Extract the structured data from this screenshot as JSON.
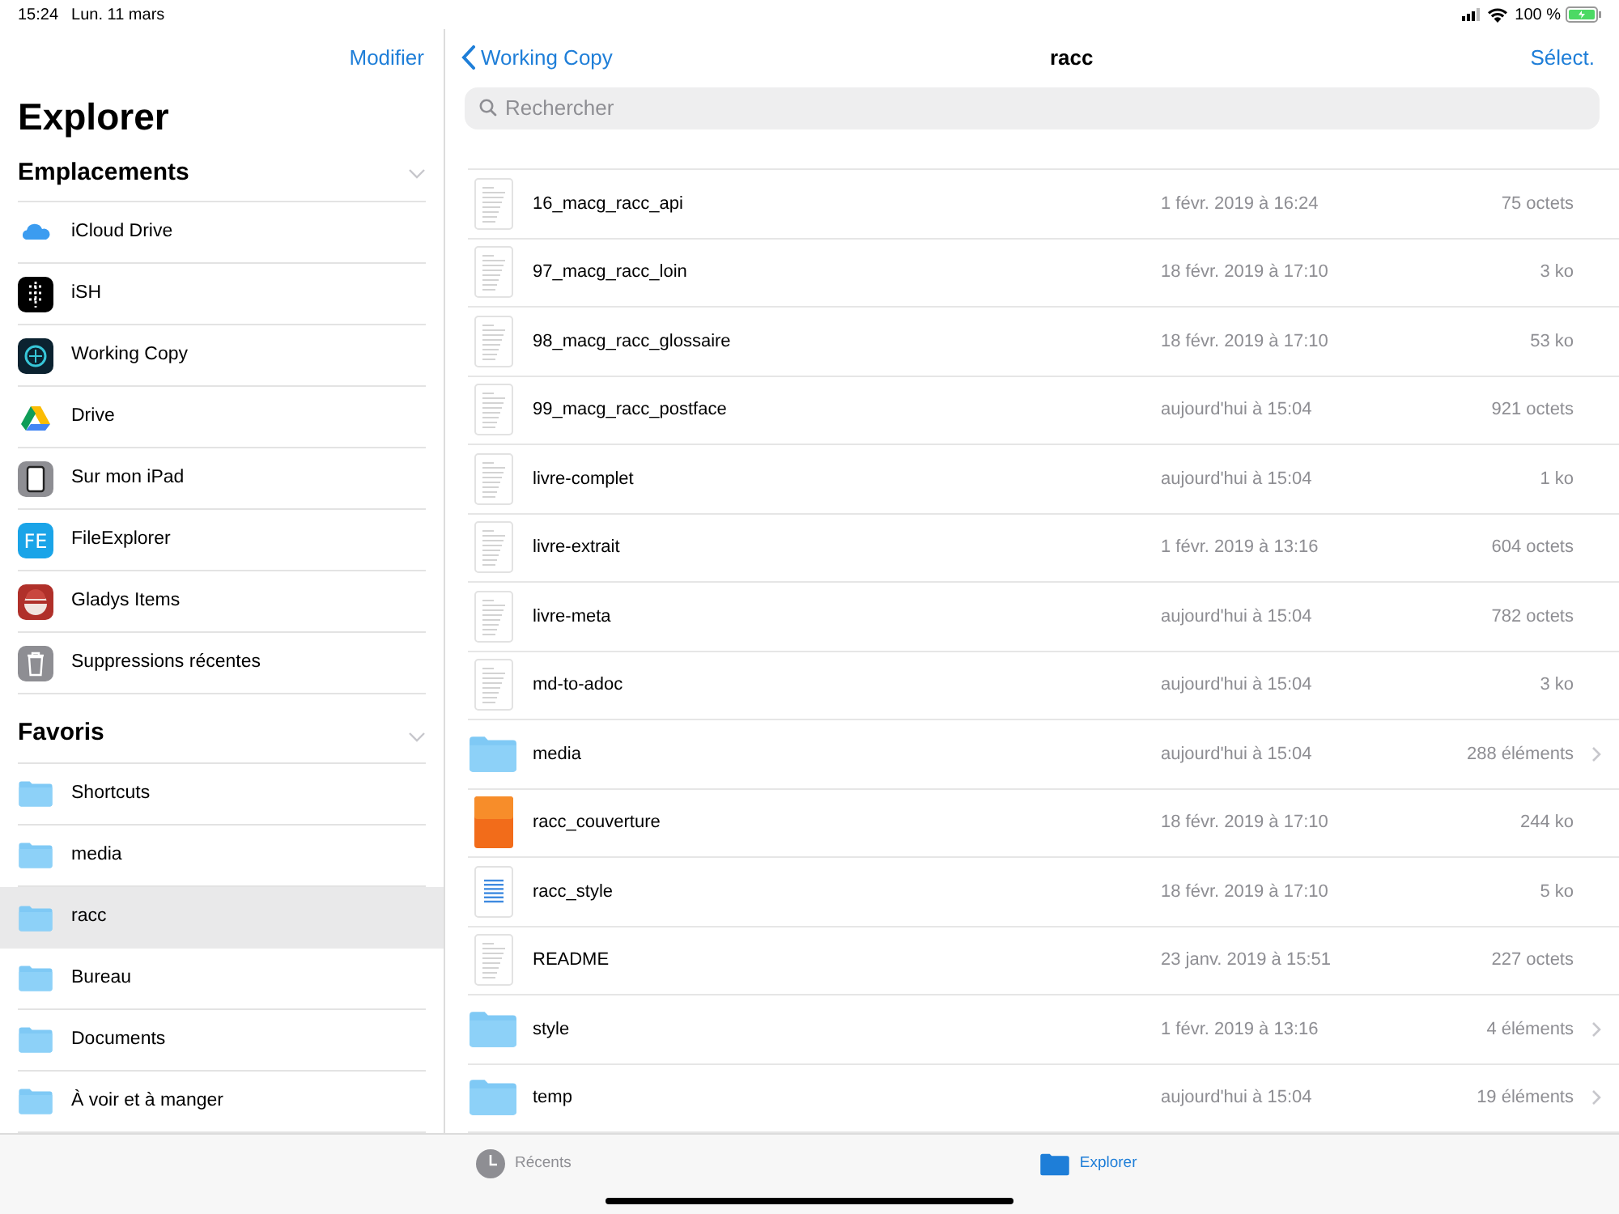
{
  "status_bar": {
    "time": "15:24",
    "date": "Lun. 11 mars",
    "battery": "100 %"
  },
  "sidebar": {
    "edit_button": "Modifier",
    "title": "Explorer",
    "sections": [
      {
        "title": "Emplacements",
        "expanded": true,
        "items": [
          {
            "label": "iCloud Drive",
            "kind": "icloud",
            "selected": false
          },
          {
            "label": "iSH",
            "kind": "ish",
            "selected": false
          },
          {
            "label": "Working Copy",
            "kind": "workingcopy",
            "selected": false
          },
          {
            "label": "Drive",
            "kind": "drive",
            "selected": false
          },
          {
            "label": "Sur mon iPad",
            "kind": "ipad",
            "selected": false
          },
          {
            "label": "FileExplorer",
            "kind": "fileexplorer",
            "icon_text": "FE",
            "selected": false
          },
          {
            "label": "Gladys Items",
            "kind": "gladys",
            "selected": false
          },
          {
            "label": "Suppressions récentes",
            "kind": "trash",
            "selected": false
          }
        ]
      },
      {
        "title": "Favoris",
        "expanded": true,
        "items": [
          {
            "label": "Shortcuts",
            "kind": "folder",
            "selected": false
          },
          {
            "label": "media",
            "kind": "folder",
            "selected": false
          },
          {
            "label": "racc",
            "kind": "folder",
            "selected": true
          },
          {
            "label": "Bureau",
            "kind": "folder",
            "selected": false
          },
          {
            "label": "Documents",
            "kind": "folder",
            "selected": false
          },
          {
            "label": "À voir et à manger",
            "kind": "folder",
            "selected": false
          }
        ]
      }
    ]
  },
  "navigation": {
    "back": "Working Copy",
    "title": "racc",
    "select": "Sélect."
  },
  "search": {
    "placeholder": "Rechercher"
  },
  "files": [
    {
      "name": "16_macg_racc_api",
      "kind": "doc",
      "date": "1 févr. 2019 à 16:24",
      "size": "75 octets"
    },
    {
      "name": "97_macg_racc_loin",
      "kind": "doc",
      "date": "18 févr. 2019 à 17:10",
      "size": "3 ko"
    },
    {
      "name": "98_macg_racc_glossaire",
      "kind": "doc",
      "date": "18 févr. 2019 à 17:10",
      "size": "53 ko"
    },
    {
      "name": "99_macg_racc_postface",
      "kind": "doc",
      "date": "aujourd'hui à 15:04",
      "size": "921 octets"
    },
    {
      "name": "livre-complet",
      "kind": "doc",
      "date": "aujourd'hui à 15:04",
      "size": "1 ko"
    },
    {
      "name": "livre-extrait",
      "kind": "doc",
      "date": "1 févr. 2019 à 13:16",
      "size": "604 octets"
    },
    {
      "name": "livre-meta",
      "kind": "doc",
      "date": "aujourd'hui à 15:04",
      "size": "782 octets"
    },
    {
      "name": "md-to-adoc",
      "kind": "doc",
      "date": "aujourd'hui à 15:04",
      "size": "3 ko"
    },
    {
      "name": "media",
      "kind": "folder",
      "date": "aujourd'hui à 15:04",
      "size": "288 éléments"
    },
    {
      "name": "racc_couverture",
      "kind": "image",
      "date": "18 févr. 2019 à 17:10",
      "size": "244 ko"
    },
    {
      "name": "racc_style",
      "kind": "text",
      "date": "18 févr. 2019 à 17:10",
      "size": "5 ko"
    },
    {
      "name": "README",
      "kind": "doc",
      "date": "23 janv. 2019 à 15:51",
      "size": "227 octets"
    },
    {
      "name": "style",
      "kind": "folder",
      "date": "1 févr. 2019 à 13:16",
      "size": "4 éléments"
    },
    {
      "name": "temp",
      "kind": "folder",
      "date": "aujourd'hui à 15:04",
      "size": "19 éléments"
    }
  ],
  "tab_bar": [
    {
      "label": "Récents",
      "kind": "clock",
      "selected": false
    },
    {
      "label": "Explorer",
      "kind": "folder",
      "selected": true
    }
  ]
}
